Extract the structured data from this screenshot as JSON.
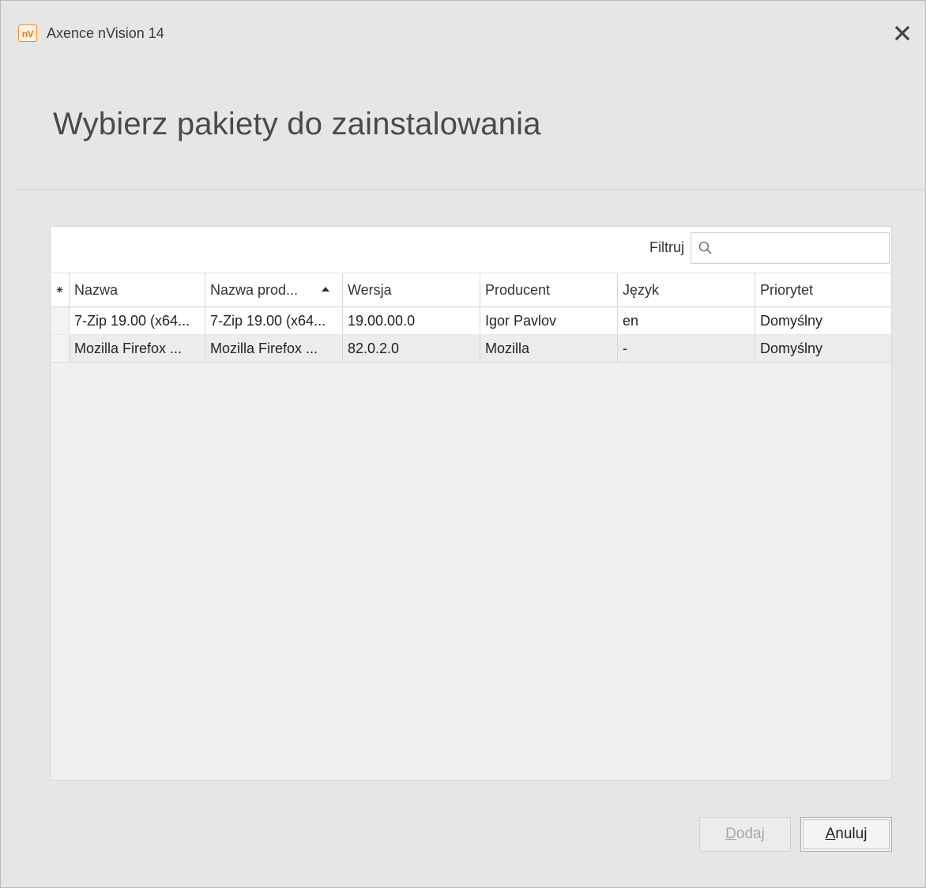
{
  "window": {
    "logo_text": "nV",
    "title": "Axence nVision 14",
    "close_icon": "close-icon"
  },
  "header": {
    "title": "Wybierz pakiety do zainstalowania"
  },
  "filter": {
    "label": "Filtruj",
    "value": "",
    "placeholder": "",
    "icon": "search-icon"
  },
  "grid": {
    "indicator_symbol": "⁕",
    "columns": [
      {
        "label": "Nazwa",
        "sorted": false
      },
      {
        "label": "Nazwa prod...",
        "sorted": true,
        "sort_direction": "ascending"
      },
      {
        "label": "Wersja",
        "sorted": false
      },
      {
        "label": "Producent",
        "sorted": false
      },
      {
        "label": "Język",
        "sorted": false
      },
      {
        "label": "Priorytet",
        "sorted": false
      }
    ],
    "rows": [
      [
        "7-Zip 19.00 (x64...",
        "7-Zip 19.00 (x64...",
        "19.00.00.0",
        "Igor Pavlov",
        "en",
        "Domyślny"
      ],
      [
        "Mozilla Firefox ...",
        "Mozilla Firefox ...",
        "82.0.2.0",
        "Mozilla",
        "-",
        "Domyślny"
      ]
    ]
  },
  "buttons": {
    "add_label": "Dodaj",
    "add_enabled": false,
    "cancel_label": "Anuluj"
  },
  "colors": {
    "logo_accent": "#f08a1c",
    "window_bg": "#e6e6e6",
    "panel_bg": "#f0f0f0"
  }
}
